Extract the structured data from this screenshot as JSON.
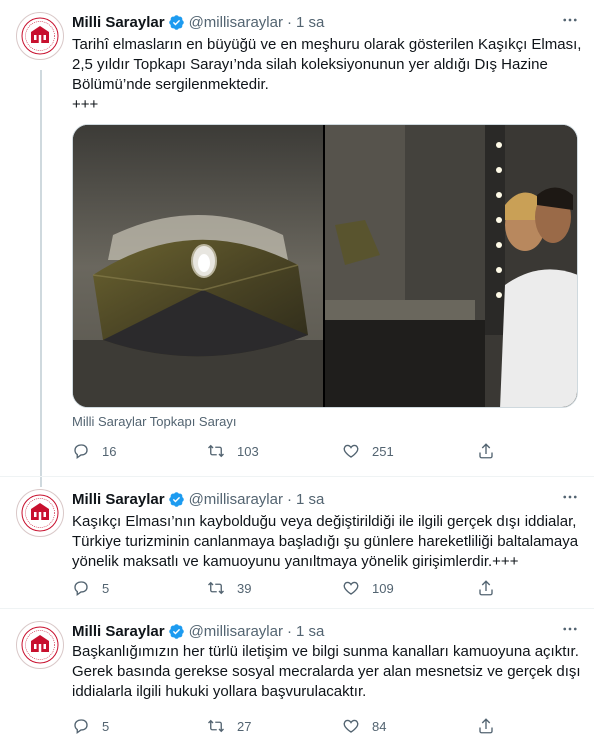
{
  "account": {
    "name": "Milli Saraylar",
    "handle": "@millisaraylar",
    "dot": "·"
  },
  "tweets": [
    {
      "time": "1 sa",
      "lines": [
        "Tarihî elmasların en büyüğü ve en meşhuru olarak gösterilen Kaşıkçı Elması,",
        "2,5 yıldır Topkapı Sarayı’nda silah koleksiyonunun yer aldığı Dış Hazine",
        "Bölümü’nde sergilenmektedir.",
        "+++"
      ],
      "media_caption": "Milli Saraylar Topkapı Sarayı",
      "replies": "16",
      "retweets": "103",
      "likes": "251"
    },
    {
      "time": "1 sa",
      "lines": [
        "Kaşıkçı Elması’nın kaybolduğu veya değiştirildiği ile ilgili gerçek dışı iddialar,",
        "Türkiye turizminin canlanmaya başladığı şu günlere hareketliliği baltalamaya",
        "yönelik maksatlı ve kamuoyunu yanıltmaya yönelik girişimlerdir.+++"
      ],
      "replies": "5",
      "retweets": "39",
      "likes": "109"
    },
    {
      "time": "1 sa",
      "lines": [
        "Başkanlığımızın her türlü iletişim ve bilgi sunma kanalları kamuoyuna açıktır.",
        "Gerek basında gerekse sosyal mecralarda yer alan mesnetsiz ve gerçek dışı",
        "iddialarla ilgili hukuki yollara başvurulacaktır."
      ],
      "replies": "5",
      "retweets": "27",
      "likes": "84"
    }
  ],
  "colors": {
    "text": "#0f1419",
    "secondary": "#536471",
    "verified": "#1d9bf0",
    "thread_line": "#cfd9de",
    "logo_red": "#c8102e"
  },
  "icons": [
    "palace-logo-icon",
    "verified-badge-icon",
    "more-options-icon",
    "reply-icon",
    "retweet-icon",
    "like-icon",
    "share-icon"
  ]
}
